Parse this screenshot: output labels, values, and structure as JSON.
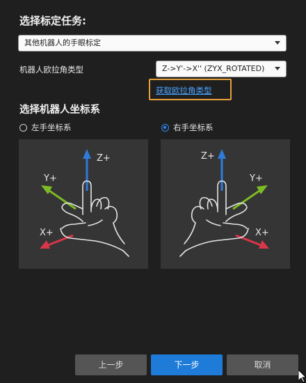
{
  "task_title": "选择标定任务:",
  "method_select": {
    "value": "其他机器人的手眼标定"
  },
  "euler": {
    "label": "机器人欧拉角类型",
    "value": "Z->Y'->X'' (ZYX_ROTATED)",
    "link": "获取欧拉角类型"
  },
  "coord_title": "选择机器人坐标系",
  "options": [
    {
      "label": "左手坐标系",
      "selected": false
    },
    {
      "label": "右手坐标系",
      "selected": true
    }
  ],
  "axes_left": {
    "z": "Z+",
    "y": "Y+",
    "x": "X+"
  },
  "axes_right": {
    "z": "Z+",
    "y": "Y+",
    "x": "X+"
  },
  "buttons": {
    "prev": "上一步",
    "next": "下一步",
    "cancel": "取消"
  },
  "colors": {
    "accent": "#1e7bd8",
    "highlight": "#e8a13a",
    "z_axis": "#2f7bdc",
    "y_axis": "#7dbb24",
    "x_axis": "#d9364a"
  }
}
